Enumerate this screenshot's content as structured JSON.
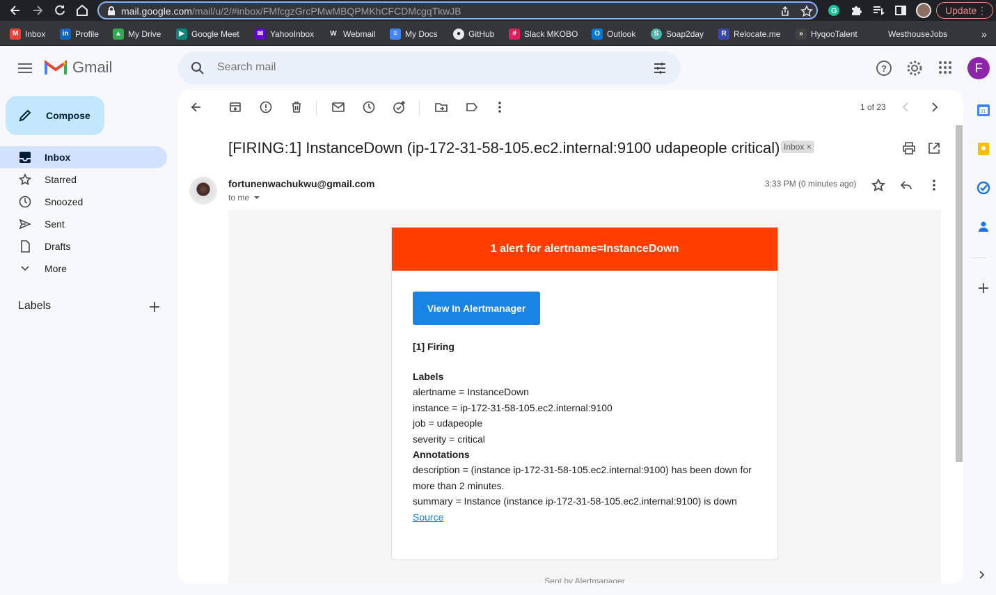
{
  "browser": {
    "url_host": "mail.google.com",
    "url_path": "/mail/u/2/#inbox/FMfcgzGrcPMwMBQPMKhCFCDMcgqTkwJB",
    "update_label": "Update"
  },
  "bookmarks": [
    {
      "label": "Inbox",
      "icon": "gmail-icon",
      "color": "#ea4335"
    },
    {
      "label": "Profile",
      "icon": "linkedin-icon",
      "color": "#0a66c2"
    },
    {
      "label": "My Drive",
      "icon": "drive-icon",
      "color": "#34a853"
    },
    {
      "label": "Google Meet",
      "icon": "meet-icon",
      "color": "#00897b"
    },
    {
      "label": "YahooInbox",
      "icon": "yahoo-icon",
      "color": "#6001d2"
    },
    {
      "label": "Webmail",
      "icon": "webmail-icon",
      "color": "#555555"
    },
    {
      "label": "My Docs",
      "icon": "docs-icon",
      "color": "#4285f4"
    },
    {
      "label": "GitHub",
      "icon": "github-icon",
      "color": "#ffffff"
    },
    {
      "label": "Slack MKOBO",
      "icon": "slack-icon",
      "color": "#e01e5a"
    },
    {
      "label": "Outlook",
      "icon": "outlook-icon",
      "color": "#0078d4"
    },
    {
      "label": "Soap2day",
      "icon": "soap2day-icon",
      "color": "#4db6ac"
    },
    {
      "label": "Relocate.me",
      "icon": "relocate-icon",
      "color": "#3949ab"
    },
    {
      "label": "HyqooTalent",
      "icon": "hyqoo-icon",
      "color": "#424242"
    },
    {
      "label": "WesthouseJobs",
      "icon": "westhouse-icon",
      "color": "#35363a"
    }
  ],
  "gmail": {
    "logo_text": "Gmail",
    "search_placeholder": "Search mail",
    "avatar_letter": "F",
    "compose_label": "Compose"
  },
  "sidebar": {
    "items": [
      {
        "label": "Inbox",
        "icon": "inbox-icon",
        "active": true
      },
      {
        "label": "Starred",
        "icon": "star-icon"
      },
      {
        "label": "Snoozed",
        "icon": "clock-icon"
      },
      {
        "label": "Sent",
        "icon": "send-icon"
      },
      {
        "label": "Drafts",
        "icon": "draft-icon"
      },
      {
        "label": "More",
        "icon": "chevron-down-icon"
      }
    ],
    "labels_heading": "Labels"
  },
  "message": {
    "counter": "1 of 23",
    "subject": "[FIRING:1] InstanceDown (ip-172-31-58-105.ec2.internal:9100 udapeople critical)",
    "chip_label": "Inbox",
    "chip_close": "×",
    "sender": "fortunenwachukwu@gmail.com",
    "to": "to me",
    "time": "3:33 PM (0 minutes ago)"
  },
  "alert": {
    "header": "1 alert for alertname=InstanceDown",
    "button": "View In Alertmanager",
    "firing": "[1] Firing",
    "labels_title": "Labels",
    "labels": [
      "alertname = InstanceDown",
      "instance = ip-172-31-58-105.ec2.internal:9100",
      "job = udapeople",
      "severity = critical"
    ],
    "annotations_title": "Annotations",
    "annotations": [
      "description = (instance ip-172-31-58-105.ec2.internal:9100) has been down for more than 2 minutes.",
      "summary = Instance (instance ip-172-31-58-105.ec2.internal:9100) is down"
    ],
    "source_link": "Source",
    "sent_by": "Sent by Alertmanager",
    "header_color": "#ff3e00",
    "button_color": "#1a84e4"
  }
}
